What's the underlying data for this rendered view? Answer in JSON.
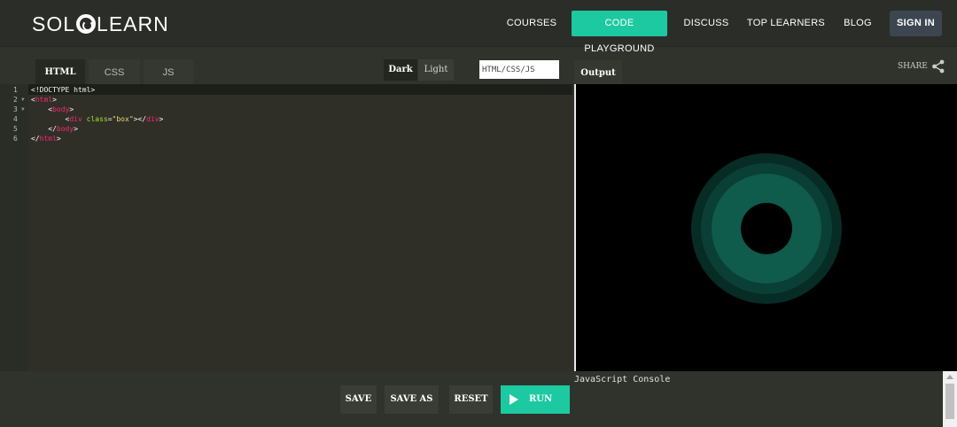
{
  "header": {
    "logo_left": "SOL",
    "logo_right": "LEARN",
    "nav": {
      "courses": "COURSES",
      "code_playground": "CODE PLAYGROUND",
      "discuss": "DISCUSS",
      "top_learners": "TOP LEARNERS",
      "blog": "BLOG",
      "sign_in": "SIGN IN"
    }
  },
  "editor": {
    "tabs": {
      "html": "HTML",
      "css": "CSS",
      "js": "JS"
    },
    "theme": {
      "dark": "Dark",
      "light": "Light"
    },
    "language_value": "HTML/CSS/JS",
    "line_numbers": [
      "1",
      "2",
      "3",
      "4",
      "5",
      "6"
    ],
    "code": {
      "l1": "<!DOCTYPE html>",
      "l2_open": "<",
      "l2_tag": "html",
      "l2_close": ">",
      "l3_open": "    <",
      "l3_tag": "body",
      "l3_close": ">",
      "l4_indent": "        <",
      "l4_tag": "div",
      "l4_attr": " class",
      "l4_eq": "=",
      "l4_val": "\"box\"",
      "l4_mid": "></",
      "l4_endtag": "div",
      "l4_end": ">",
      "l5_open": "    </",
      "l5_tag": "body",
      "l5_close": ">",
      "l6_open": "</",
      "l6_tag": "html",
      "l6_close": ">"
    }
  },
  "output": {
    "tab_label": "Output",
    "share_label": "SHARE",
    "console_label": "JavaScript Console"
  },
  "actions": {
    "save": "SAVE",
    "save_as": "SAVE AS",
    "reset": "RESET",
    "run": "RUN"
  },
  "colors": {
    "accent": "#1dc9a0",
    "tag": "#f92672",
    "attribute": "#a6e22e",
    "string": "#e6db74"
  }
}
